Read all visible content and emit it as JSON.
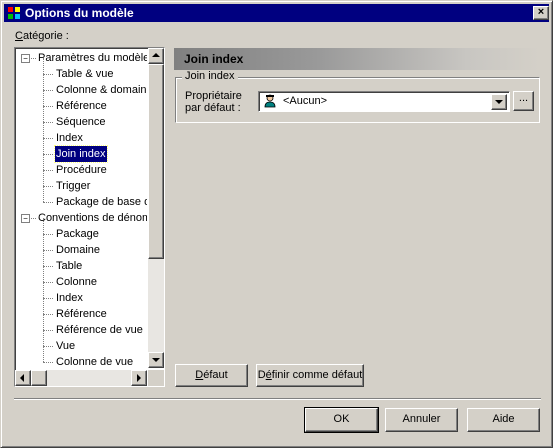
{
  "window": {
    "title": "Options du modèle"
  },
  "category_label": "Catégorie :",
  "tree": [
    {
      "label": "Paramètres du modèle",
      "level": 0,
      "expander": "−"
    },
    {
      "label": "Table & vue",
      "level": 1
    },
    {
      "label": "Colonne & domaine",
      "level": 1
    },
    {
      "label": "Référence",
      "level": 1
    },
    {
      "label": "Séquence",
      "level": 1
    },
    {
      "label": "Index",
      "level": 1
    },
    {
      "label": "Join index",
      "level": 1,
      "selected": true
    },
    {
      "label": "Procédure",
      "level": 1
    },
    {
      "label": "Trigger",
      "level": 1
    },
    {
      "label": "Package de base de données",
      "level": 1
    },
    {
      "label": "Conventions de dénomination",
      "level": 0,
      "expander": "−"
    },
    {
      "label": "Package",
      "level": 1
    },
    {
      "label": "Domaine",
      "level": 1
    },
    {
      "label": "Table",
      "level": 1
    },
    {
      "label": "Colonne",
      "level": 1
    },
    {
      "label": "Index",
      "level": 1
    },
    {
      "label": "Référence",
      "level": 1
    },
    {
      "label": "Référence de vue",
      "level": 1
    },
    {
      "label": "Vue",
      "level": 1
    },
    {
      "label": "Colonne de vue",
      "level": 1
    }
  ],
  "panel": {
    "header": "Join index",
    "group_title": "Join index",
    "owner_label_line1": "Propriétaire",
    "owner_label_line2": "par défaut :",
    "owner_value": "<Aucun>",
    "browse_label": "..."
  },
  "buttons": {
    "default": "Défaut",
    "set_default": "Définir comme défaut",
    "ok": "OK",
    "cancel": "Annuler",
    "help": "Aide",
    "close": "×"
  },
  "colors": {
    "titlebar": "#000080",
    "face": "#d4d0c8",
    "selection": "#000080"
  }
}
